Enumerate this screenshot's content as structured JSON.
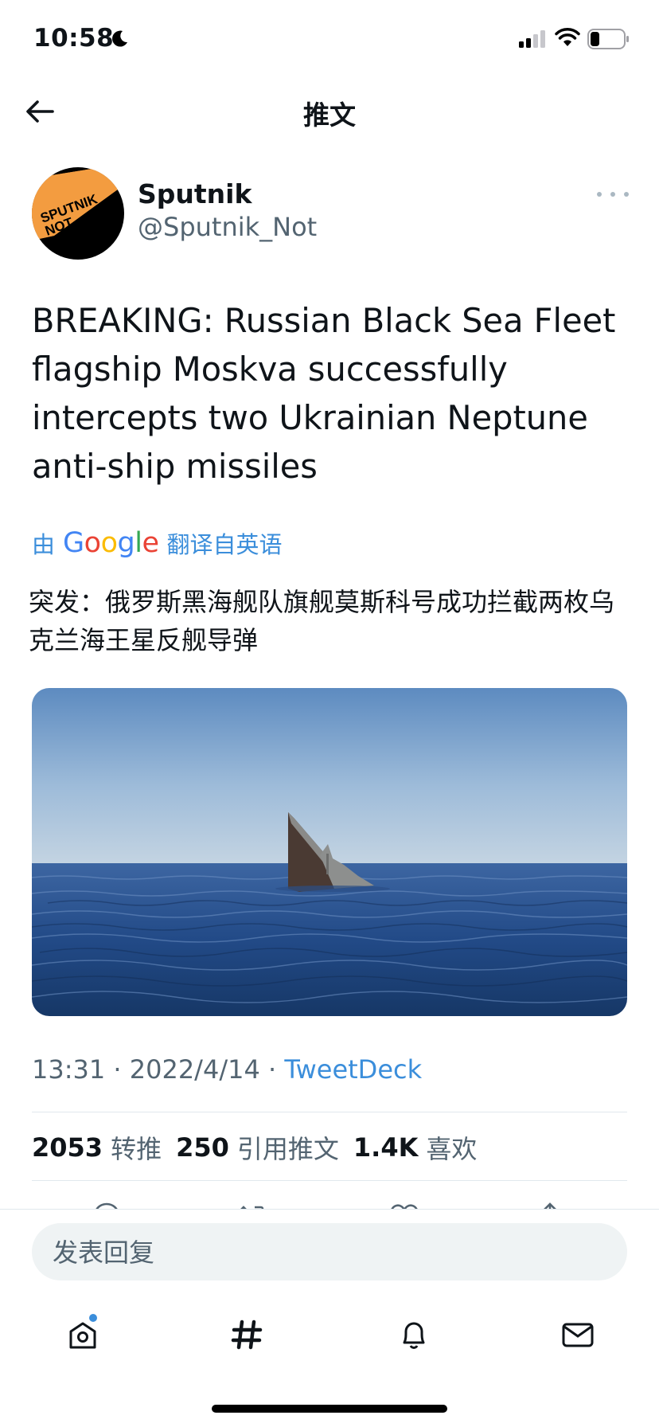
{
  "status_bar": {
    "time": "10:58"
  },
  "nav": {
    "title": "推文"
  },
  "tweet": {
    "author_name": "Sputnik",
    "author_handle": "@Sputnik_Not",
    "avatar_text": "SPUTNIK NOT",
    "text": "BREAKING: Russian Black Sea Fleet flagship Moskva successfully intercepts two Ukrainian Neptune anti-ship missiles",
    "translate_prefix": "由",
    "translate_brand": "Google",
    "translate_suffix": "翻译自英语",
    "translated_text": "突发：俄罗斯黑海舰队旗舰莫斯科号成功拦截两枚乌克兰海王星反舰导弹",
    "time": "13:31",
    "date": "2022/4/14",
    "source": "TweetDeck",
    "separator": "·"
  },
  "stats": {
    "retweets_count": "2053",
    "retweets_label": "转推",
    "quotes_count": "250",
    "quotes_label": "引用推文",
    "likes_count": "1.4K",
    "likes_label": "喜欢"
  },
  "reply": {
    "placeholder": "发表回复"
  },
  "colors": {
    "accent": "#1d9bf0",
    "text": "#0f1419",
    "muted": "#536471"
  },
  "icons": [
    "back-arrow-icon",
    "more-icon",
    "home-icon",
    "hashtag-icon",
    "bell-icon",
    "mail-icon"
  ]
}
